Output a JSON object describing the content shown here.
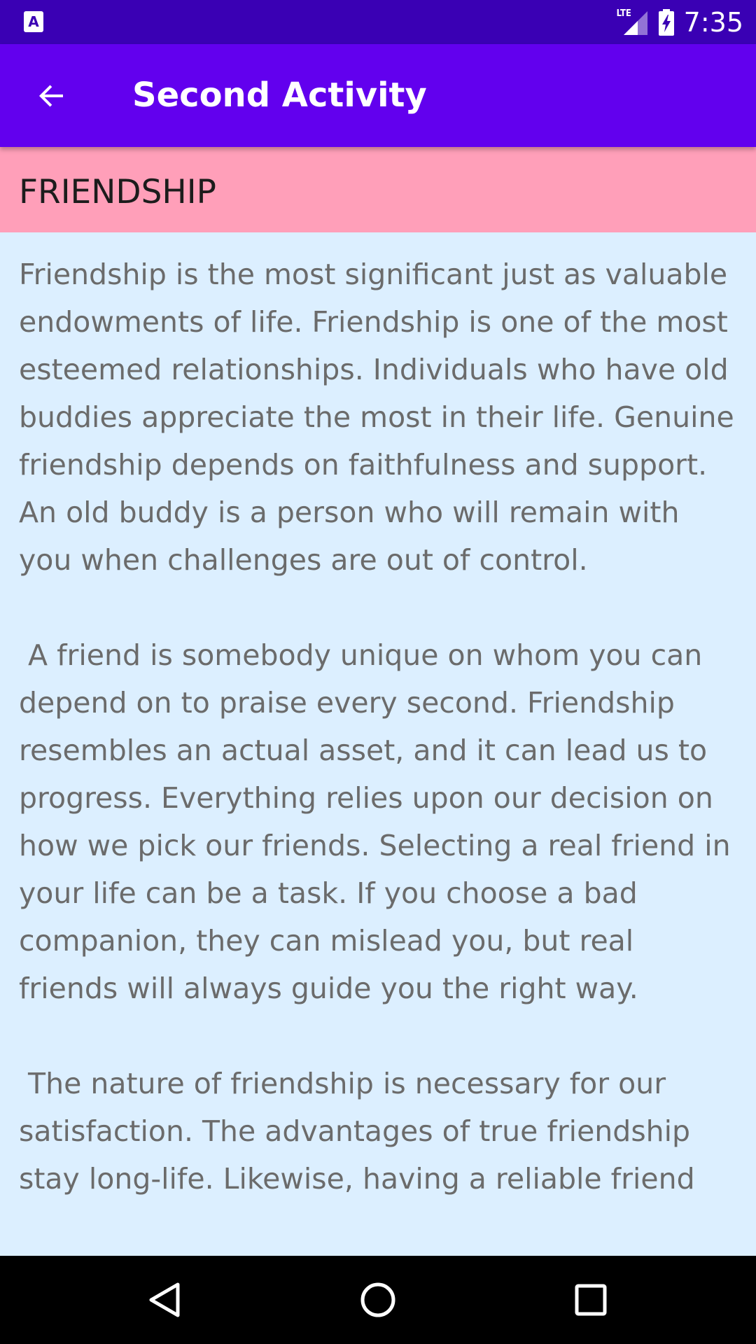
{
  "status_bar": {
    "left_icon": "A",
    "network_label": "LTE",
    "time": "7:35",
    "icons": [
      "notification-a-icon",
      "lte-signal-icon",
      "battery-charging-icon"
    ]
  },
  "app_bar": {
    "title": "Second Activity",
    "back_icon": "arrow-back-icon",
    "background_color": "#6200ee"
  },
  "header": {
    "title": "FRIENDSHIP",
    "background_color": "#ff9fb9"
  },
  "content": {
    "background_color": "#dcefff",
    "paragraphs": [
      "Friendship is the most significant just as valuable endowments of life. Friendship is one of the most esteemed relationships. Individuals who have old buddies appreciate the most in their life. Genuine friendship depends on faithfulness and support. An old buddy is a person who will remain with you when challenges are out of control.",
      " A friend is somebody unique on whom you can depend on to praise every second. Friendship resembles an actual asset, and it can lead us to progress. Everything relies upon our decision on how we pick our friends. Selecting a real friend in your life can be a task. If you choose a bad companion, they can mislead you, but real friends will always guide you the right way.",
      " The nature of friendship is necessary for our satisfaction. The advantages of true friendship stay long-life. Likewise, having a reliable friend"
    ]
  },
  "nav_bar": {
    "icons": [
      "back-triangle-icon",
      "home-circle-icon",
      "recents-square-icon"
    ]
  }
}
